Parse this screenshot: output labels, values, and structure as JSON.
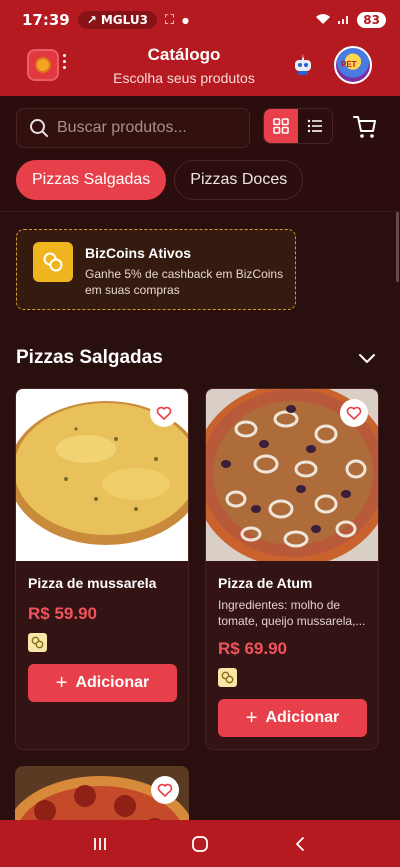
{
  "status_bar": {
    "time": "17:39",
    "pill_text": "MGLU3",
    "battery": "83"
  },
  "app_bar": {
    "title": "Catálogo",
    "subtitle": "Escolha seus produtos",
    "avatar_label": "PET"
  },
  "search": {
    "placeholder": "Buscar produtos..."
  },
  "tabs": [
    {
      "label": "Pizzas Salgadas",
      "active": true
    },
    {
      "label": "Pizzas Doces",
      "active": false
    }
  ],
  "promo": {
    "title": "BizCoins Ativos",
    "text": "Ganhe 5% de cashback em BizCoins em suas compras"
  },
  "section": {
    "title": "Pizzas Salgadas"
  },
  "products": [
    {
      "name": "Pizza de mussarela",
      "description": "",
      "price": "R$ 59.90",
      "add_label": "Adicionar"
    },
    {
      "name": "Pizza de Atum",
      "description": "Ingredientes: molho de tomate, queijo mussarela,...",
      "price": "R$ 69.90",
      "add_label": "Adicionar"
    }
  ],
  "colors": {
    "brand_red": "#b41a1f",
    "accent": "#e8404a",
    "price": "#f0535a",
    "coin": "#efb51e"
  },
  "icons": [
    "trending-up-icon",
    "screenshot-icon",
    "wifi-icon",
    "signal-icon",
    "search-icon",
    "grid-view-icon",
    "list-view-icon",
    "cart-icon",
    "heart-icon",
    "coin-icon",
    "chevron-down-icon",
    "robot-icon",
    "menu-icon",
    "home-icon",
    "back-icon"
  ]
}
